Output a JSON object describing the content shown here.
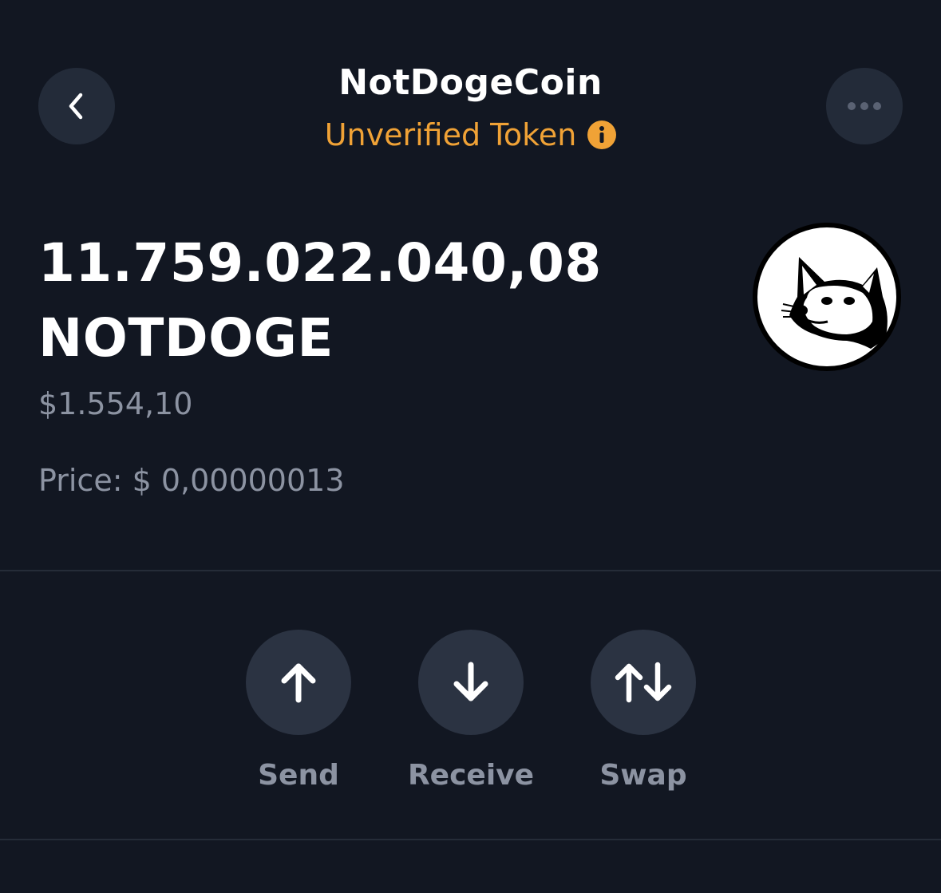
{
  "header": {
    "title": "NotDogeCoin",
    "subtitle": "Unverified Token",
    "subtitle_color": "#f0a236",
    "back_icon": "chevron-left-icon",
    "more_icon": "ellipsis-icon",
    "info_icon": "info-icon"
  },
  "balance": {
    "amount": "11.759.022.040,08",
    "symbol": "NOTDOGE",
    "fiat_value": "$1.554,10",
    "price": "Price: $ 0,00000013"
  },
  "token_logo": "doge-logo",
  "actions": [
    {
      "label": "Send",
      "icon": "arrow-up-icon"
    },
    {
      "label": "Receive",
      "icon": "arrow-down-icon"
    },
    {
      "label": "Swap",
      "icon": "swap-arrows-icon"
    }
  ],
  "colors": {
    "background": "#121722",
    "button_bg": "#2b3342",
    "muted_text": "#8c93a2",
    "warning": "#f0a236"
  }
}
